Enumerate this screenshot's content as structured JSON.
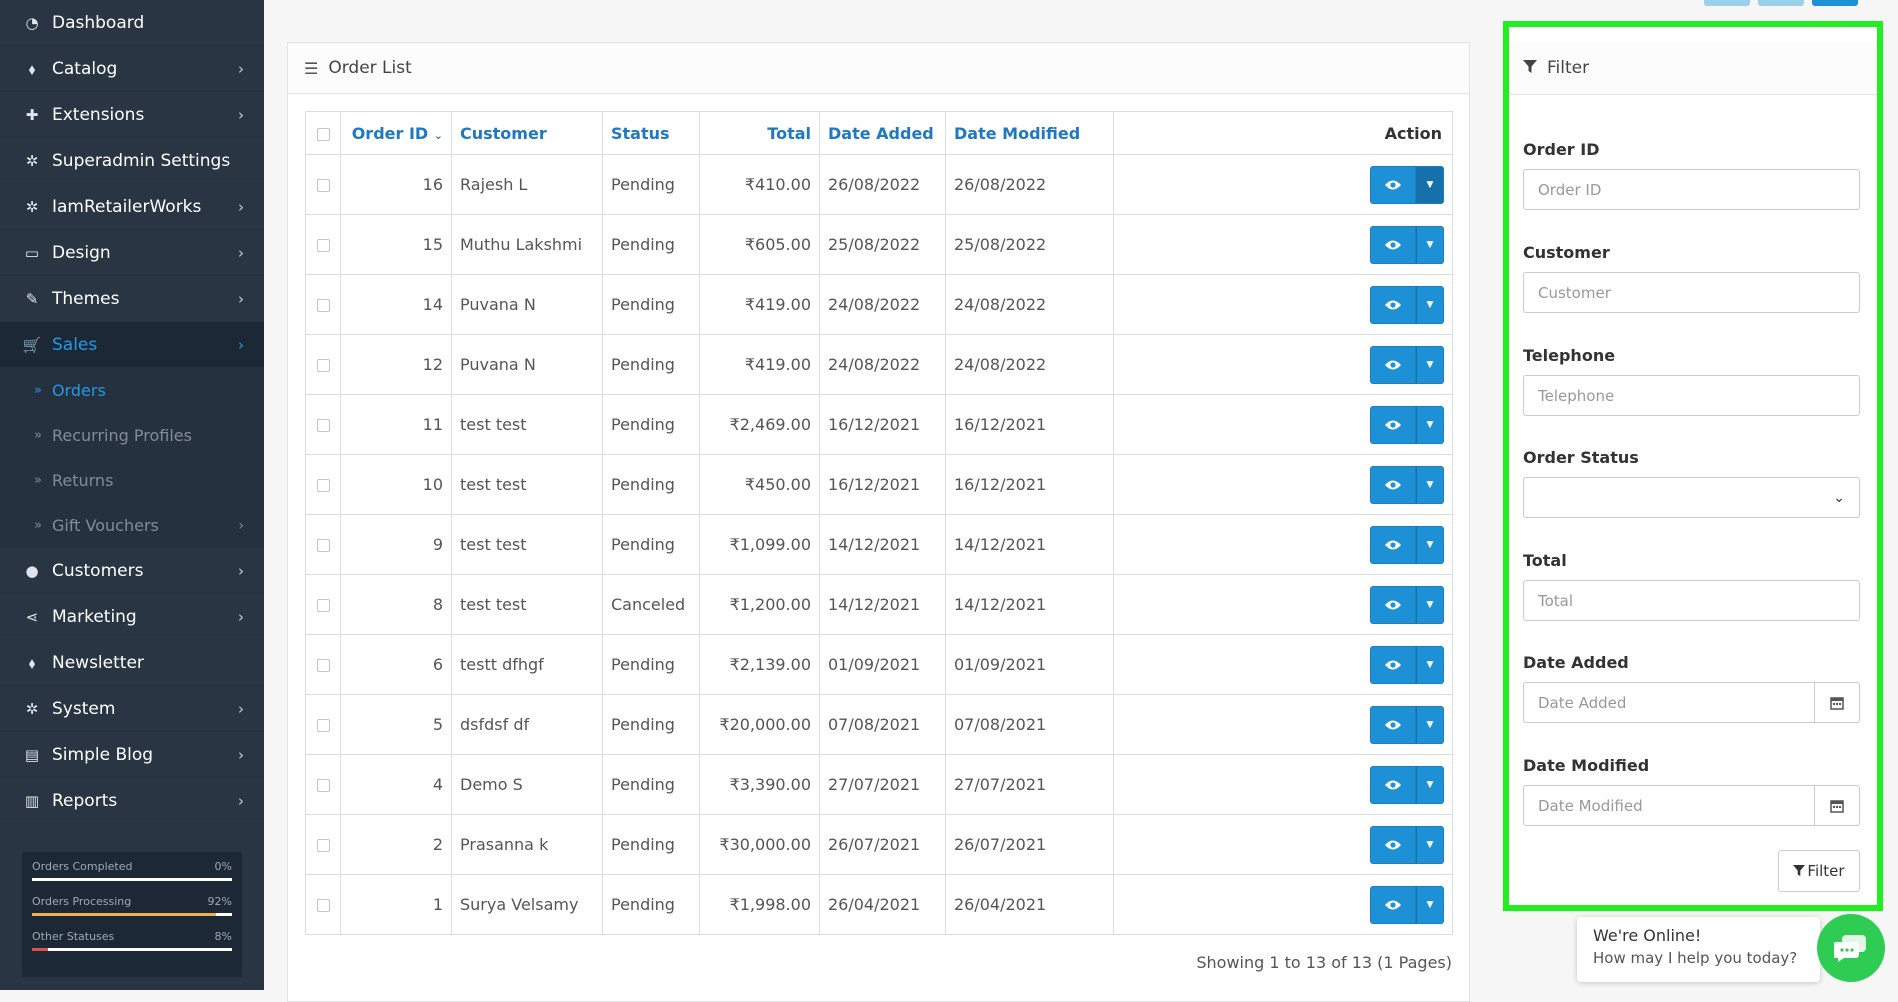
{
  "sidebar": {
    "items": [
      {
        "label": "Dashboard",
        "icon": "dashboard-icon",
        "chevron": false
      },
      {
        "label": "Catalog",
        "icon": "tags-icon",
        "chevron": true
      },
      {
        "label": "Extensions",
        "icon": "puzzle-icon",
        "chevron": true
      },
      {
        "label": "Superadmin Settings",
        "icon": "cogs-icon",
        "chevron": false
      },
      {
        "label": "IamRetailerWorks",
        "icon": "cogs-icon",
        "chevron": true
      },
      {
        "label": "Design",
        "icon": "desktop-icon",
        "chevron": true
      },
      {
        "label": "Themes",
        "icon": "brush-icon",
        "chevron": true
      },
      {
        "label": "Sales",
        "icon": "cart-icon",
        "chevron": true,
        "active": true
      }
    ],
    "sub_items": [
      {
        "label": "Orders",
        "active": true,
        "chevron": false
      },
      {
        "label": "Recurring Profiles",
        "active": false,
        "chevron": false
      },
      {
        "label": "Returns",
        "active": false,
        "chevron": false
      },
      {
        "label": "Gift Vouchers",
        "active": false,
        "chevron": true
      }
    ],
    "items_after": [
      {
        "label": "Customers",
        "icon": "user-icon",
        "chevron": true
      },
      {
        "label": "Marketing",
        "icon": "share-icon",
        "chevron": true
      },
      {
        "label": "Newsletter",
        "icon": "tags-icon",
        "chevron": false
      },
      {
        "label": "System",
        "icon": "cog-icon",
        "chevron": true
      },
      {
        "label": "Simple Blog",
        "icon": "file-icon",
        "chevron": true
      },
      {
        "label": "Reports",
        "icon": "bar-chart-icon",
        "chevron": true
      }
    ],
    "stats": [
      {
        "label": "Orders Completed",
        "percent_text": "0%",
        "percent": 0,
        "color": "#1e9be6"
      },
      {
        "label": "Orders Processing",
        "percent_text": "92%",
        "percent": 92,
        "color": "#f0ad4e"
      },
      {
        "label": "Other Statuses",
        "percent_text": "8%",
        "percent": 8,
        "color": "#d9534f"
      }
    ]
  },
  "order_list": {
    "title": "Order List",
    "columns": {
      "order_id": "Order ID",
      "customer": "Customer",
      "status": "Status",
      "total": "Total",
      "date_added": "Date Added",
      "date_modified": "Date Modified",
      "action": "Action"
    },
    "rows": [
      {
        "id": "16",
        "customer": "Rajesh L",
        "status": "Pending",
        "total": "₹410.00",
        "added": "26/08/2022",
        "modified": "26/08/2022"
      },
      {
        "id": "15",
        "customer": "Muthu Lakshmi",
        "status": "Pending",
        "total": "₹605.00",
        "added": "25/08/2022",
        "modified": "25/08/2022"
      },
      {
        "id": "14",
        "customer": "Puvana N",
        "status": "Pending",
        "total": "₹419.00",
        "added": "24/08/2022",
        "modified": "24/08/2022"
      },
      {
        "id": "12",
        "customer": "Puvana N",
        "status": "Pending",
        "total": "₹419.00",
        "added": "24/08/2022",
        "modified": "24/08/2022"
      },
      {
        "id": "11",
        "customer": "test test",
        "status": "Pending",
        "total": "₹2,469.00",
        "added": "16/12/2021",
        "modified": "16/12/2021"
      },
      {
        "id": "10",
        "customer": "test test",
        "status": "Pending",
        "total": "₹450.00",
        "added": "16/12/2021",
        "modified": "16/12/2021"
      },
      {
        "id": "9",
        "customer": "test test",
        "status": "Pending",
        "total": "₹1,099.00",
        "added": "14/12/2021",
        "modified": "14/12/2021"
      },
      {
        "id": "8",
        "customer": "test test",
        "status": "Canceled",
        "total": "₹1,200.00",
        "added": "14/12/2021",
        "modified": "14/12/2021"
      },
      {
        "id": "6",
        "customer": "testt dfhgf",
        "status": "Pending",
        "total": "₹2,139.00",
        "added": "01/09/2021",
        "modified": "01/09/2021"
      },
      {
        "id": "5",
        "customer": "dsfdsf df",
        "status": "Pending",
        "total": "₹20,000.00",
        "added": "07/08/2021",
        "modified": "07/08/2021"
      },
      {
        "id": "4",
        "customer": "Demo S",
        "status": "Pending",
        "total": "₹3,390.00",
        "added": "27/07/2021",
        "modified": "27/07/2021"
      },
      {
        "id": "2",
        "customer": "Prasanna k",
        "status": "Pending",
        "total": "₹30,000.00",
        "added": "26/07/2021",
        "modified": "26/07/2021"
      },
      {
        "id": "1",
        "customer": "Surya Velsamy",
        "status": "Pending",
        "total": "₹1,998.00",
        "added": "26/04/2021",
        "modified": "26/04/2021"
      }
    ],
    "showing_text": "Showing 1 to 13 of 13 (1 Pages)"
  },
  "filter": {
    "title": "Filter",
    "order_id": {
      "label": "Order ID",
      "placeholder": "Order ID"
    },
    "customer": {
      "label": "Customer",
      "placeholder": "Customer"
    },
    "telephone": {
      "label": "Telephone",
      "placeholder": "Telephone"
    },
    "order_status": {
      "label": "Order Status",
      "value": ""
    },
    "total": {
      "label": "Total",
      "placeholder": "Total"
    },
    "date_added": {
      "label": "Date Added",
      "placeholder": "Date Added"
    },
    "date_modified": {
      "label": "Date Modified",
      "placeholder": "Date Modified"
    },
    "button_label": "Filter"
  },
  "chat": {
    "title": "We're Online!",
    "subtitle": "How may I help you today?"
  },
  "colors": {
    "sidebar_bg": "#2a3543",
    "accent": "#1e91d6",
    "highlight_border": "#22ee22",
    "chat_green": "#2ecc52"
  }
}
